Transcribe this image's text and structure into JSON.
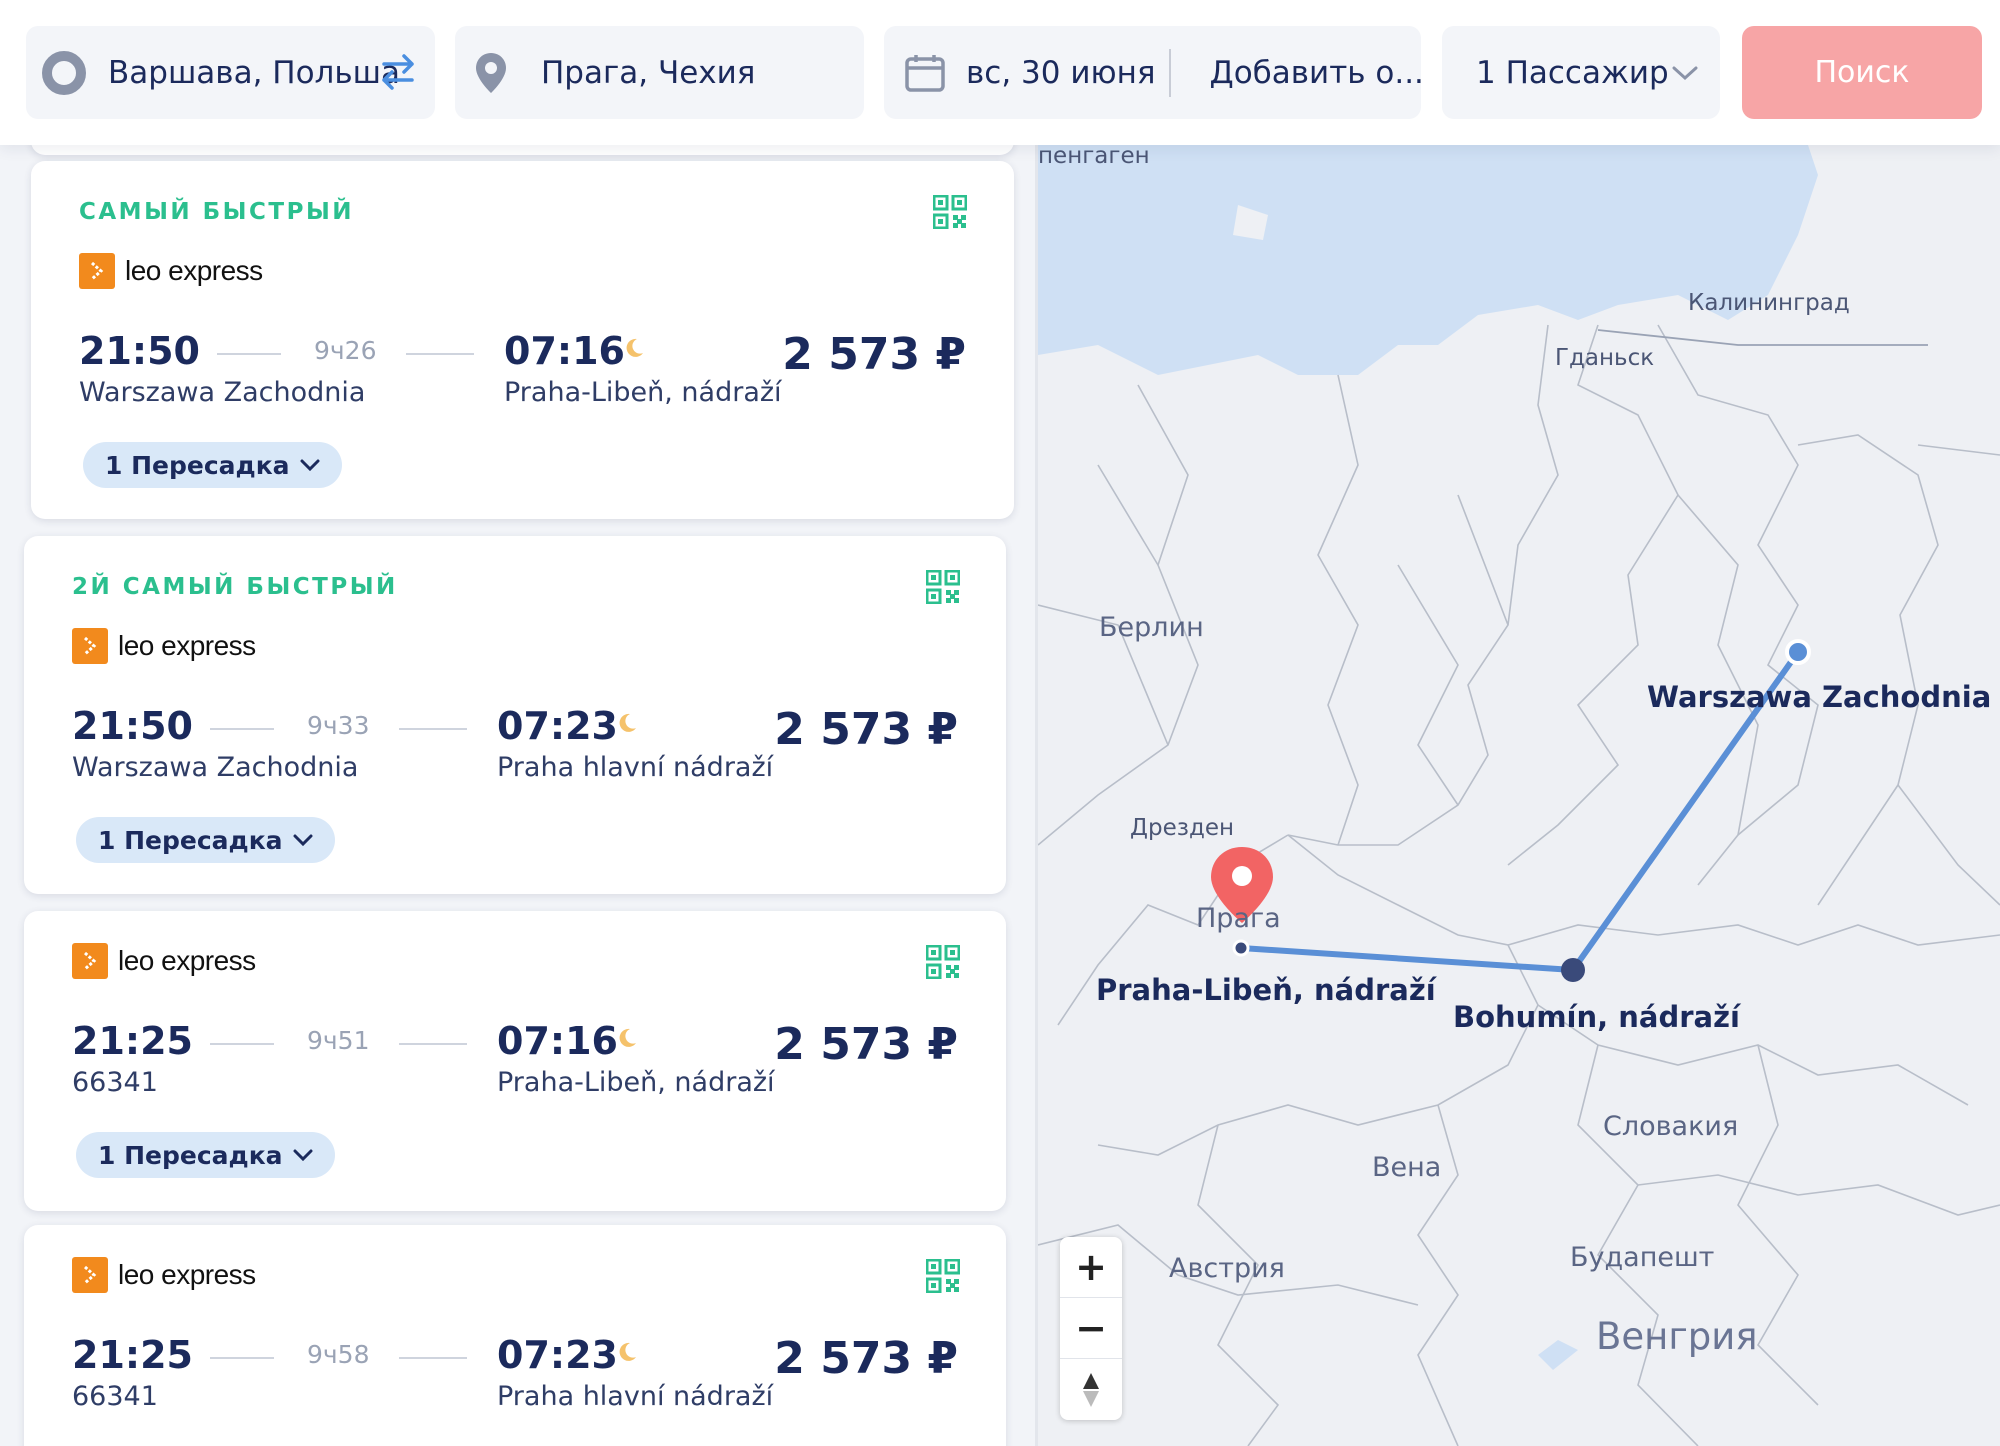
{
  "search": {
    "from": "Варшава, Польша",
    "to": "Прага, Чехия",
    "date": "вс, 30 июня",
    "return_placeholder": "Добавить о...",
    "passengers": "1 Пассажир",
    "search_button": "Поиск"
  },
  "results": [
    {
      "tag": "САМЫЙ БЫСТРЫЙ",
      "carrier": "leo express",
      "depart_time": "21:50",
      "duration": "9ч26",
      "arrive_time": "07:16",
      "depart_station": "Warszawa Zachodnia",
      "arrive_station": "Praha-Libeň, nádraží",
      "price": "2 573 ₽",
      "transfers": "1 Пересадка"
    },
    {
      "tag": "2Й САМЫЙ БЫСТРЫЙ",
      "carrier": "leo express",
      "depart_time": "21:50",
      "duration": "9ч33",
      "arrive_time": "07:23",
      "depart_station": "Warszawa Zachodnia",
      "arrive_station": "Praha hlavní nádraží",
      "price": "2 573 ₽",
      "transfers": "1 Пересадка"
    },
    {
      "tag": "",
      "carrier": "leo express",
      "depart_time": "21:25",
      "duration": "9ч51",
      "arrive_time": "07:16",
      "depart_station": "66341",
      "arrive_station": "Praha-Libeň, nádraží",
      "price": "2 573 ₽",
      "transfers": "1 Пересадка"
    },
    {
      "tag": "",
      "carrier": "leo express",
      "depart_time": "21:25",
      "duration": "9ч58",
      "arrive_time": "07:23",
      "depart_station": "66341",
      "arrive_station": "Praha hlavní nádraží",
      "price": "2 573 ₽",
      "transfers": ""
    }
  ],
  "map": {
    "cities": {
      "kopenhagen": "пенгаген",
      "kaliningrad": "Калининград",
      "gdansk": "Гданьск",
      "berlin": "Берлин",
      "dresden": "Дрезден",
      "praga": "Прага",
      "vena": "Вена",
      "budapest": "Будапешт",
      "austria": "Австрия",
      "slovakia": "Словакия",
      "hungary": "Венгрия"
    },
    "stations": {
      "warsaw": "Warszawa Zachodnia",
      "bohumin": "Bohumín, nádraží",
      "praha": "Praha-Libeň, nádraží"
    },
    "zoom_in": "+",
    "zoom_out": "−",
    "route_color": "#5a8fd6",
    "marker_color": "#f26464"
  },
  "colors": {
    "accent_green": "#2bbf8e",
    "primary_text": "#1b2a5c",
    "search_button": "#f7a5a6",
    "carrier_orange": "#f28a1d"
  }
}
